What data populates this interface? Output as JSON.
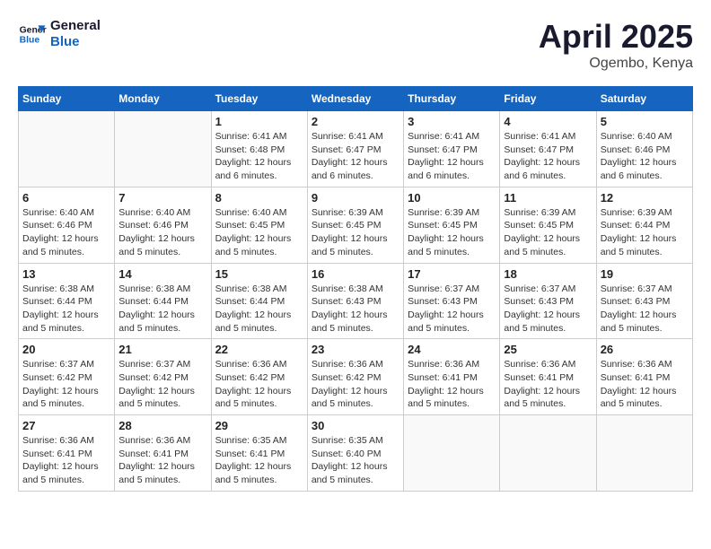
{
  "header": {
    "logo_line1": "General",
    "logo_line2": "Blue",
    "month": "April 2025",
    "location": "Ogembo, Kenya"
  },
  "weekdays": [
    "Sunday",
    "Monday",
    "Tuesday",
    "Wednesday",
    "Thursday",
    "Friday",
    "Saturday"
  ],
  "weeks": [
    [
      {
        "day": "",
        "info": ""
      },
      {
        "day": "",
        "info": ""
      },
      {
        "day": "1",
        "info": "Sunrise: 6:41 AM\nSunset: 6:48 PM\nDaylight: 12 hours\nand 6 minutes."
      },
      {
        "day": "2",
        "info": "Sunrise: 6:41 AM\nSunset: 6:47 PM\nDaylight: 12 hours\nand 6 minutes."
      },
      {
        "day": "3",
        "info": "Sunrise: 6:41 AM\nSunset: 6:47 PM\nDaylight: 12 hours\nand 6 minutes."
      },
      {
        "day": "4",
        "info": "Sunrise: 6:41 AM\nSunset: 6:47 PM\nDaylight: 12 hours\nand 6 minutes."
      },
      {
        "day": "5",
        "info": "Sunrise: 6:40 AM\nSunset: 6:46 PM\nDaylight: 12 hours\nand 6 minutes."
      }
    ],
    [
      {
        "day": "6",
        "info": "Sunrise: 6:40 AM\nSunset: 6:46 PM\nDaylight: 12 hours\nand 5 minutes."
      },
      {
        "day": "7",
        "info": "Sunrise: 6:40 AM\nSunset: 6:46 PM\nDaylight: 12 hours\nand 5 minutes."
      },
      {
        "day": "8",
        "info": "Sunrise: 6:40 AM\nSunset: 6:45 PM\nDaylight: 12 hours\nand 5 minutes."
      },
      {
        "day": "9",
        "info": "Sunrise: 6:39 AM\nSunset: 6:45 PM\nDaylight: 12 hours\nand 5 minutes."
      },
      {
        "day": "10",
        "info": "Sunrise: 6:39 AM\nSunset: 6:45 PM\nDaylight: 12 hours\nand 5 minutes."
      },
      {
        "day": "11",
        "info": "Sunrise: 6:39 AM\nSunset: 6:45 PM\nDaylight: 12 hours\nand 5 minutes."
      },
      {
        "day": "12",
        "info": "Sunrise: 6:39 AM\nSunset: 6:44 PM\nDaylight: 12 hours\nand 5 minutes."
      }
    ],
    [
      {
        "day": "13",
        "info": "Sunrise: 6:38 AM\nSunset: 6:44 PM\nDaylight: 12 hours\nand 5 minutes."
      },
      {
        "day": "14",
        "info": "Sunrise: 6:38 AM\nSunset: 6:44 PM\nDaylight: 12 hours\nand 5 minutes."
      },
      {
        "day": "15",
        "info": "Sunrise: 6:38 AM\nSunset: 6:44 PM\nDaylight: 12 hours\nand 5 minutes."
      },
      {
        "day": "16",
        "info": "Sunrise: 6:38 AM\nSunset: 6:43 PM\nDaylight: 12 hours\nand 5 minutes."
      },
      {
        "day": "17",
        "info": "Sunrise: 6:37 AM\nSunset: 6:43 PM\nDaylight: 12 hours\nand 5 minutes."
      },
      {
        "day": "18",
        "info": "Sunrise: 6:37 AM\nSunset: 6:43 PM\nDaylight: 12 hours\nand 5 minutes."
      },
      {
        "day": "19",
        "info": "Sunrise: 6:37 AM\nSunset: 6:43 PM\nDaylight: 12 hours\nand 5 minutes."
      }
    ],
    [
      {
        "day": "20",
        "info": "Sunrise: 6:37 AM\nSunset: 6:42 PM\nDaylight: 12 hours\nand 5 minutes."
      },
      {
        "day": "21",
        "info": "Sunrise: 6:37 AM\nSunset: 6:42 PM\nDaylight: 12 hours\nand 5 minutes."
      },
      {
        "day": "22",
        "info": "Sunrise: 6:36 AM\nSunset: 6:42 PM\nDaylight: 12 hours\nand 5 minutes."
      },
      {
        "day": "23",
        "info": "Sunrise: 6:36 AM\nSunset: 6:42 PM\nDaylight: 12 hours\nand 5 minutes."
      },
      {
        "day": "24",
        "info": "Sunrise: 6:36 AM\nSunset: 6:41 PM\nDaylight: 12 hours\nand 5 minutes."
      },
      {
        "day": "25",
        "info": "Sunrise: 6:36 AM\nSunset: 6:41 PM\nDaylight: 12 hours\nand 5 minutes."
      },
      {
        "day": "26",
        "info": "Sunrise: 6:36 AM\nSunset: 6:41 PM\nDaylight: 12 hours\nand 5 minutes."
      }
    ],
    [
      {
        "day": "27",
        "info": "Sunrise: 6:36 AM\nSunset: 6:41 PM\nDaylight: 12 hours\nand 5 minutes."
      },
      {
        "day": "28",
        "info": "Sunrise: 6:36 AM\nSunset: 6:41 PM\nDaylight: 12 hours\nand 5 minutes."
      },
      {
        "day": "29",
        "info": "Sunrise: 6:35 AM\nSunset: 6:41 PM\nDaylight: 12 hours\nand 5 minutes."
      },
      {
        "day": "30",
        "info": "Sunrise: 6:35 AM\nSunset: 6:40 PM\nDaylight: 12 hours\nand 5 minutes."
      },
      {
        "day": "",
        "info": ""
      },
      {
        "day": "",
        "info": ""
      },
      {
        "day": "",
        "info": ""
      }
    ]
  ]
}
